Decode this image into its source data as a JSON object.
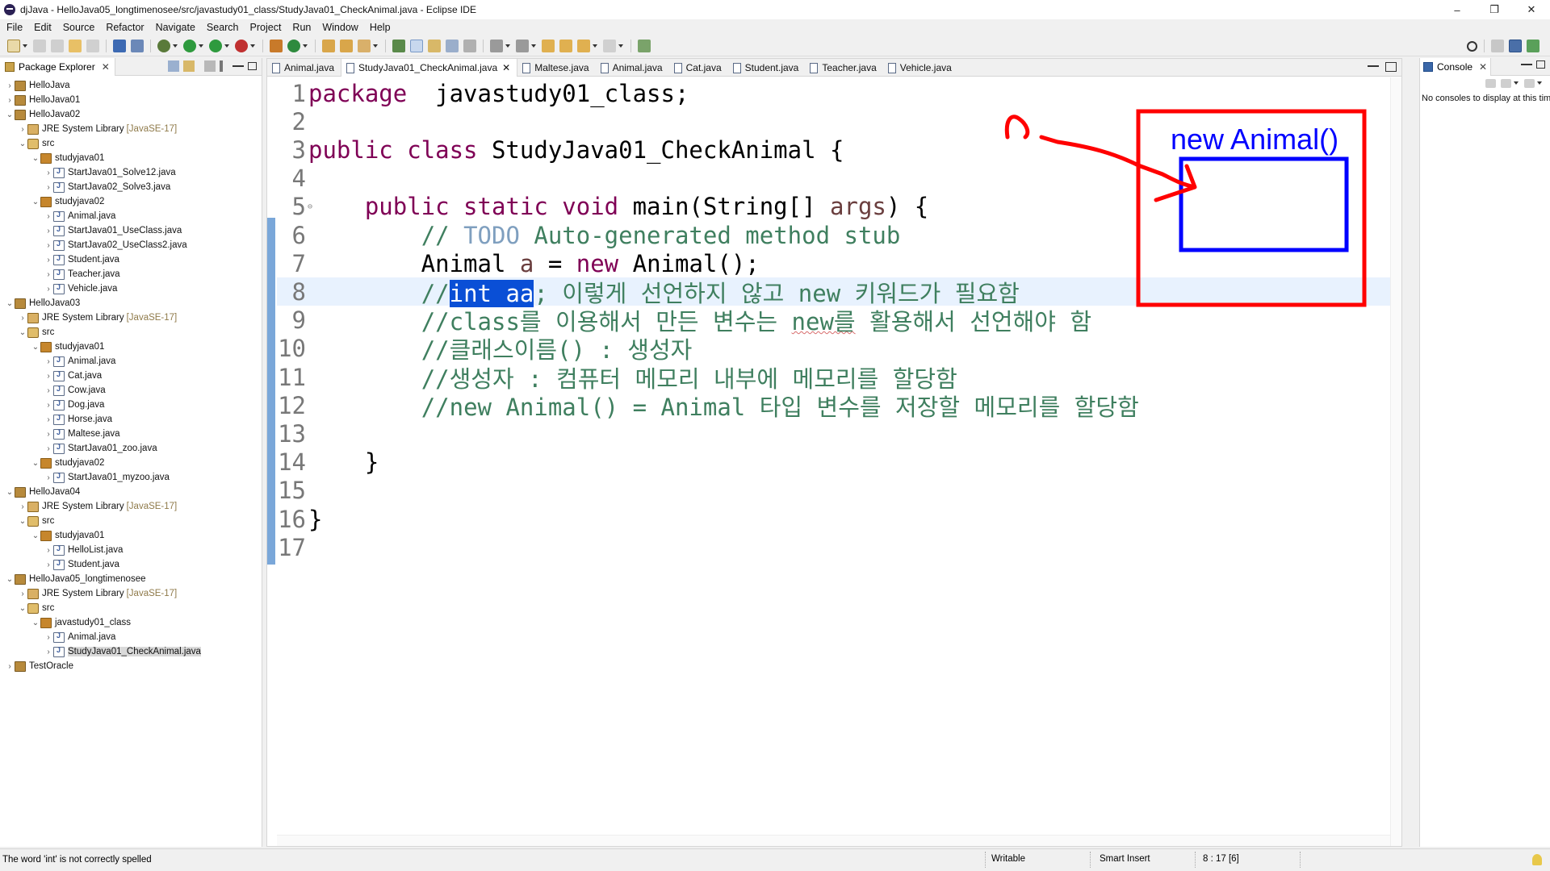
{
  "window": {
    "title": "djJava - HelloJava05_longtimenosee/src/javastudy01_class/StudyJava01_CheckAnimal.java - Eclipse IDE",
    "controls": [
      "–",
      "❐",
      "✕"
    ]
  },
  "menu": [
    "File",
    "Edit",
    "Source",
    "Refactor",
    "Navigate",
    "Search",
    "Project",
    "Run",
    "Window",
    "Help"
  ],
  "package_explorer": {
    "tab_label": "Package Explorer",
    "tree": [
      {
        "label": "HelloJava",
        "depth": 0,
        "icon": "project",
        "expanded": false
      },
      {
        "label": "HelloJava01",
        "depth": 0,
        "icon": "project",
        "expanded": false
      },
      {
        "label": "HelloJava02",
        "depth": 0,
        "icon": "project",
        "expanded": true
      },
      {
        "label": "JRE System Library",
        "decor": "[JavaSE-17]",
        "depth": 1,
        "icon": "jre",
        "expanded": false
      },
      {
        "label": "src",
        "depth": 1,
        "icon": "src",
        "expanded": true
      },
      {
        "label": "studyjava01",
        "depth": 2,
        "icon": "pkg",
        "expanded": true
      },
      {
        "label": "StartJava01_Solve12.java",
        "depth": 3,
        "icon": "java",
        "expanded": false
      },
      {
        "label": "StartJava02_Solve3.java",
        "depth": 3,
        "icon": "java",
        "expanded": false
      },
      {
        "label": "studyjava02",
        "depth": 2,
        "icon": "pkg",
        "expanded": true
      },
      {
        "label": "Animal.java",
        "depth": 3,
        "icon": "java",
        "expanded": false
      },
      {
        "label": "StartJava01_UseClass.java",
        "depth": 3,
        "icon": "java",
        "expanded": false
      },
      {
        "label": "StartJava02_UseClass2.java",
        "depth": 3,
        "icon": "java",
        "expanded": false
      },
      {
        "label": "Student.java",
        "depth": 3,
        "icon": "java",
        "expanded": false
      },
      {
        "label": "Teacher.java",
        "depth": 3,
        "icon": "java",
        "expanded": false
      },
      {
        "label": "Vehicle.java",
        "depth": 3,
        "icon": "java",
        "expanded": false
      },
      {
        "label": "HelloJava03",
        "depth": 0,
        "icon": "project",
        "expanded": true
      },
      {
        "label": "JRE System Library",
        "decor": "[JavaSE-17]",
        "depth": 1,
        "icon": "jre",
        "expanded": false
      },
      {
        "label": "src",
        "depth": 1,
        "icon": "src",
        "expanded": true
      },
      {
        "label": "studyjava01",
        "depth": 2,
        "icon": "pkg",
        "expanded": true
      },
      {
        "label": "Animal.java",
        "depth": 3,
        "icon": "java",
        "expanded": false
      },
      {
        "label": "Cat.java",
        "depth": 3,
        "icon": "java",
        "expanded": false
      },
      {
        "label": "Cow.java",
        "depth": 3,
        "icon": "java",
        "expanded": false
      },
      {
        "label": "Dog.java",
        "depth": 3,
        "icon": "java",
        "expanded": false
      },
      {
        "label": "Horse.java",
        "depth": 3,
        "icon": "java",
        "expanded": false
      },
      {
        "label": "Maltese.java",
        "depth": 3,
        "icon": "java",
        "expanded": false
      },
      {
        "label": "StartJava01_zoo.java",
        "depth": 3,
        "icon": "java",
        "expanded": false
      },
      {
        "label": "studyjava02",
        "depth": 2,
        "icon": "pkg",
        "expanded": true
      },
      {
        "label": "StartJava01_myzoo.java",
        "depth": 3,
        "icon": "java",
        "expanded": false
      },
      {
        "label": "HelloJava04",
        "depth": 0,
        "icon": "project",
        "expanded": true
      },
      {
        "label": "JRE System Library",
        "decor": "[JavaSE-17]",
        "depth": 1,
        "icon": "jre",
        "expanded": false
      },
      {
        "label": "src",
        "depth": 1,
        "icon": "src",
        "expanded": true
      },
      {
        "label": "studyjava01",
        "depth": 2,
        "icon": "pkg",
        "expanded": true
      },
      {
        "label": "HelloList.java",
        "depth": 3,
        "icon": "java",
        "expanded": false
      },
      {
        "label": "Student.java",
        "depth": 3,
        "icon": "java",
        "expanded": false
      },
      {
        "label": "HelloJava05_longtimenosee",
        "depth": 0,
        "icon": "project",
        "expanded": true
      },
      {
        "label": "JRE System Library",
        "decor": "[JavaSE-17]",
        "depth": 1,
        "icon": "jre",
        "expanded": false
      },
      {
        "label": "src",
        "depth": 1,
        "icon": "src",
        "expanded": true
      },
      {
        "label": "javastudy01_class",
        "depth": 2,
        "icon": "pkg",
        "expanded": true
      },
      {
        "label": "Animal.java",
        "depth": 3,
        "icon": "java",
        "expanded": false
      },
      {
        "label": "StudyJava01_CheckAnimal.java",
        "depth": 3,
        "icon": "java",
        "expanded": false,
        "selected": true
      },
      {
        "label": "TestOracle",
        "depth": 0,
        "icon": "project",
        "expanded": false
      }
    ]
  },
  "editor_tabs": [
    {
      "label": "Animal.java",
      "active": false
    },
    {
      "label": "StudyJava01_CheckAnimal.java",
      "active": true
    },
    {
      "label": "Maltese.java",
      "active": false
    },
    {
      "label": "Animal.java",
      "active": false
    },
    {
      "label": "Cat.java",
      "active": false
    },
    {
      "label": "Student.java",
      "active": false
    },
    {
      "label": "Teacher.java",
      "active": false
    },
    {
      "label": "Vehicle.java",
      "active": false
    }
  ],
  "code": {
    "current_line": 8,
    "lines": [
      {
        "n": "1",
        "seg": [
          [
            "kw",
            "package"
          ],
          [
            "",
            "  javastudy01_class;"
          ]
        ]
      },
      {
        "n": "2",
        "seg": []
      },
      {
        "n": "3",
        "seg": [
          [
            "kw",
            "public class"
          ],
          [
            "",
            " StudyJava01_CheckAnimal {"
          ]
        ]
      },
      {
        "n": "4",
        "seg": []
      },
      {
        "n": "5",
        "seg": [
          [
            "",
            "    "
          ],
          [
            "kw",
            "public static void"
          ],
          [
            "",
            " main(String[] "
          ],
          [
            "var",
            "args"
          ],
          [
            "",
            ") {"
          ]
        ]
      },
      {
        "n": "6",
        "seg": [
          [
            "",
            "        "
          ],
          [
            "cm",
            "// "
          ],
          [
            "todo",
            "TODO"
          ],
          [
            "cm",
            " Auto-generated method stub"
          ]
        ]
      },
      {
        "n": "7",
        "seg": [
          [
            "",
            "        Animal "
          ],
          [
            "var",
            "a"
          ],
          [
            "",
            " = "
          ],
          [
            "kw",
            "new"
          ],
          [
            "",
            " Animal();"
          ]
        ]
      },
      {
        "n": "8",
        "seg": [
          [
            "",
            "        "
          ],
          [
            "cm",
            "//"
          ],
          [
            "sel",
            "int aa"
          ],
          [
            "cm",
            "; 이렇게 선언하지 않고 new 키워드가 필요함"
          ]
        ]
      },
      {
        "n": "9",
        "seg": [
          [
            "",
            "        "
          ],
          [
            "cm",
            "//class를 이용해서 만든 변수는 "
          ],
          [
            "cm squig",
            "new를"
          ],
          [
            "cm",
            " 활용해서 선언해야 함"
          ]
        ]
      },
      {
        "n": "10",
        "seg": [
          [
            "",
            "        "
          ],
          [
            "cm",
            "//클래스이름() : 생성자"
          ]
        ]
      },
      {
        "n": "11",
        "seg": [
          [
            "",
            "        "
          ],
          [
            "cm",
            "//생성자 : 컴퓨터 메모리 내부에 메모리를 할당함"
          ]
        ]
      },
      {
        "n": "12",
        "seg": [
          [
            "",
            "        "
          ],
          [
            "cm",
            "//new Animal() = Animal 타입 변수를 저장할 메모리를 할당함"
          ]
        ]
      },
      {
        "n": "13",
        "seg": []
      },
      {
        "n": "14",
        "seg": [
          [
            "",
            "    }"
          ]
        ]
      },
      {
        "n": "15",
        "seg": []
      },
      {
        "n": "16",
        "seg": [
          [
            "",
            "}"
          ]
        ]
      },
      {
        "n": "17",
        "seg": []
      }
    ]
  },
  "annotation": {
    "label": "new Animal()",
    "outer_color": "#ff0000",
    "inner_color": "#0000ff"
  },
  "console": {
    "tab_label": "Console",
    "empty_text": "No consoles to display at this time."
  },
  "status": {
    "message": "The word 'int' is not correctly spelled",
    "mode": "Writable",
    "insert": "Smart Insert",
    "position": "8 : 17 [6]"
  }
}
